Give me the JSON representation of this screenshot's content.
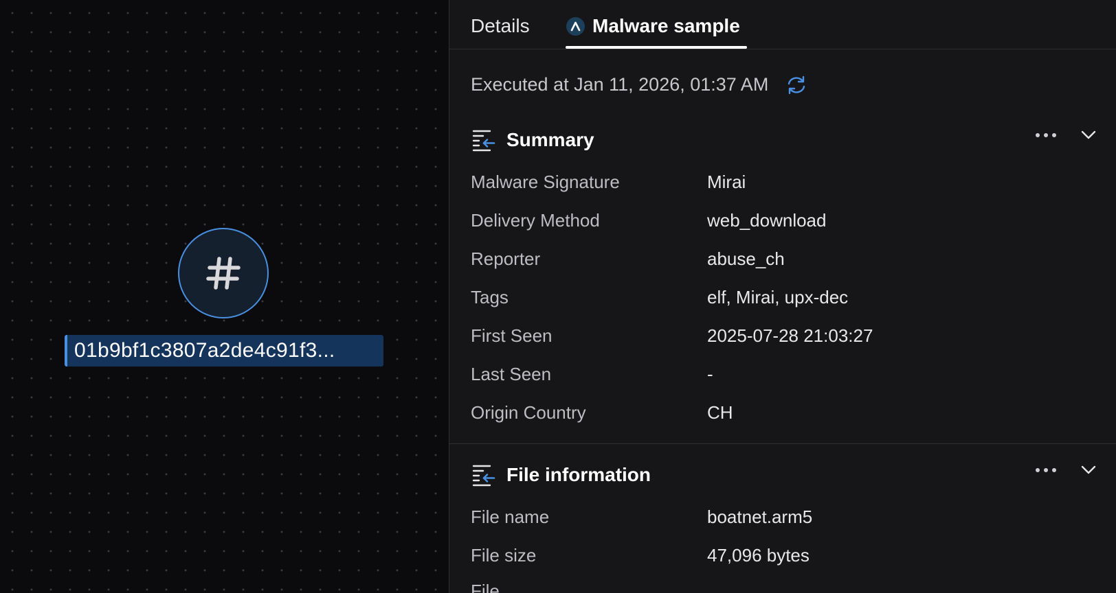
{
  "canvas": {
    "node_label": "01b9bf1c3807a2de4c91f3...",
    "node_icon": "hash-icon"
  },
  "tabs": [
    {
      "label": "Details",
      "active": false
    },
    {
      "label": "Malware sample",
      "active": true,
      "icon": "brand-logo-icon"
    }
  ],
  "executed": {
    "text": "Executed at Jan 11, 2026, 01:37 AM",
    "refresh_icon": "refresh-icon"
  },
  "summary": {
    "title": "Summary",
    "rows": [
      {
        "key": "Malware Signature",
        "value": "Mirai"
      },
      {
        "key": "Delivery Method",
        "value": "web_download"
      },
      {
        "key": "Reporter",
        "value": "abuse_ch"
      },
      {
        "key": "Tags",
        "value": "elf, Mirai, upx-dec"
      },
      {
        "key": "First Seen",
        "value": "2025-07-28 21:03:27"
      },
      {
        "key": "Last Seen",
        "value": "-"
      },
      {
        "key": "Origin Country",
        "value": "CH"
      }
    ]
  },
  "file_info": {
    "title": "File information",
    "rows": [
      {
        "key": "File name",
        "value": "boatnet.arm5"
      },
      {
        "key": "File size",
        "value": "47,096 bytes"
      }
    ],
    "partial_label": "File"
  },
  "colors": {
    "accent": "#4a90e2",
    "panel_bg": "#161618",
    "canvas_bg": "#0b0b0d"
  }
}
